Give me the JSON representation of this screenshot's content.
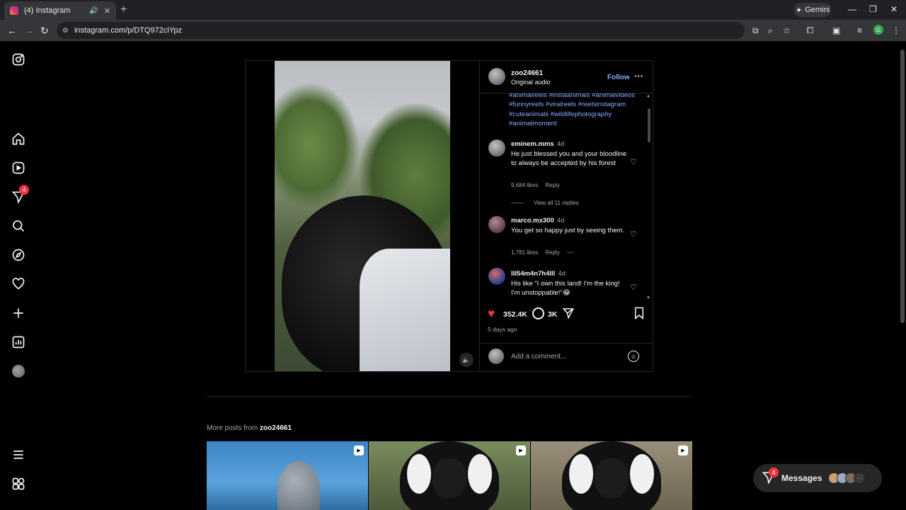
{
  "browser": {
    "tab_title": "(4) Instagram",
    "url": "instagram.com/p/DTQ972ciYpz",
    "gemini_label": "Gemini"
  },
  "leftnav": {
    "notification_count": "4"
  },
  "post": {
    "username": "zoo24661",
    "audio": "Original audio",
    "follow_label": "Follow",
    "hashtags": "#animalreels #instaanimals #animalvideos #funnyreels #viralreels #reelsinstagram #cuteanimals #wildlifephotography #animalmoment",
    "comments": [
      {
        "user": "eminem.mms",
        "age": "4d",
        "text": "He just blessed you and your bloodline to always be accepted by his forest",
        "likes": "9,684 likes",
        "reply": "Reply",
        "view_replies": "View all 11 replies"
      },
      {
        "user": "marco.mx300",
        "age": "4d",
        "text": "You get so happy just by seeing them.",
        "likes": "1,781 likes",
        "reply": "Reply"
      },
      {
        "user": "lll54m4n7h4lll",
        "age": "4d",
        "text": "His like \"I own this land! I'm the king! I'm unstoppable!\"😂"
      }
    ],
    "like_count": "352.4K",
    "comment_count": "3K",
    "time_ago": "5 days ago",
    "add_comment_placeholder": "Add a comment..."
  },
  "more_posts": {
    "prefix": "More posts from",
    "username": "zoo24661"
  },
  "messages": {
    "label": "Messages",
    "badge": "4"
  },
  "colors": {
    "accent_link": "#8aa8ff",
    "like_red": "#ff3040",
    "background": "#000000"
  }
}
